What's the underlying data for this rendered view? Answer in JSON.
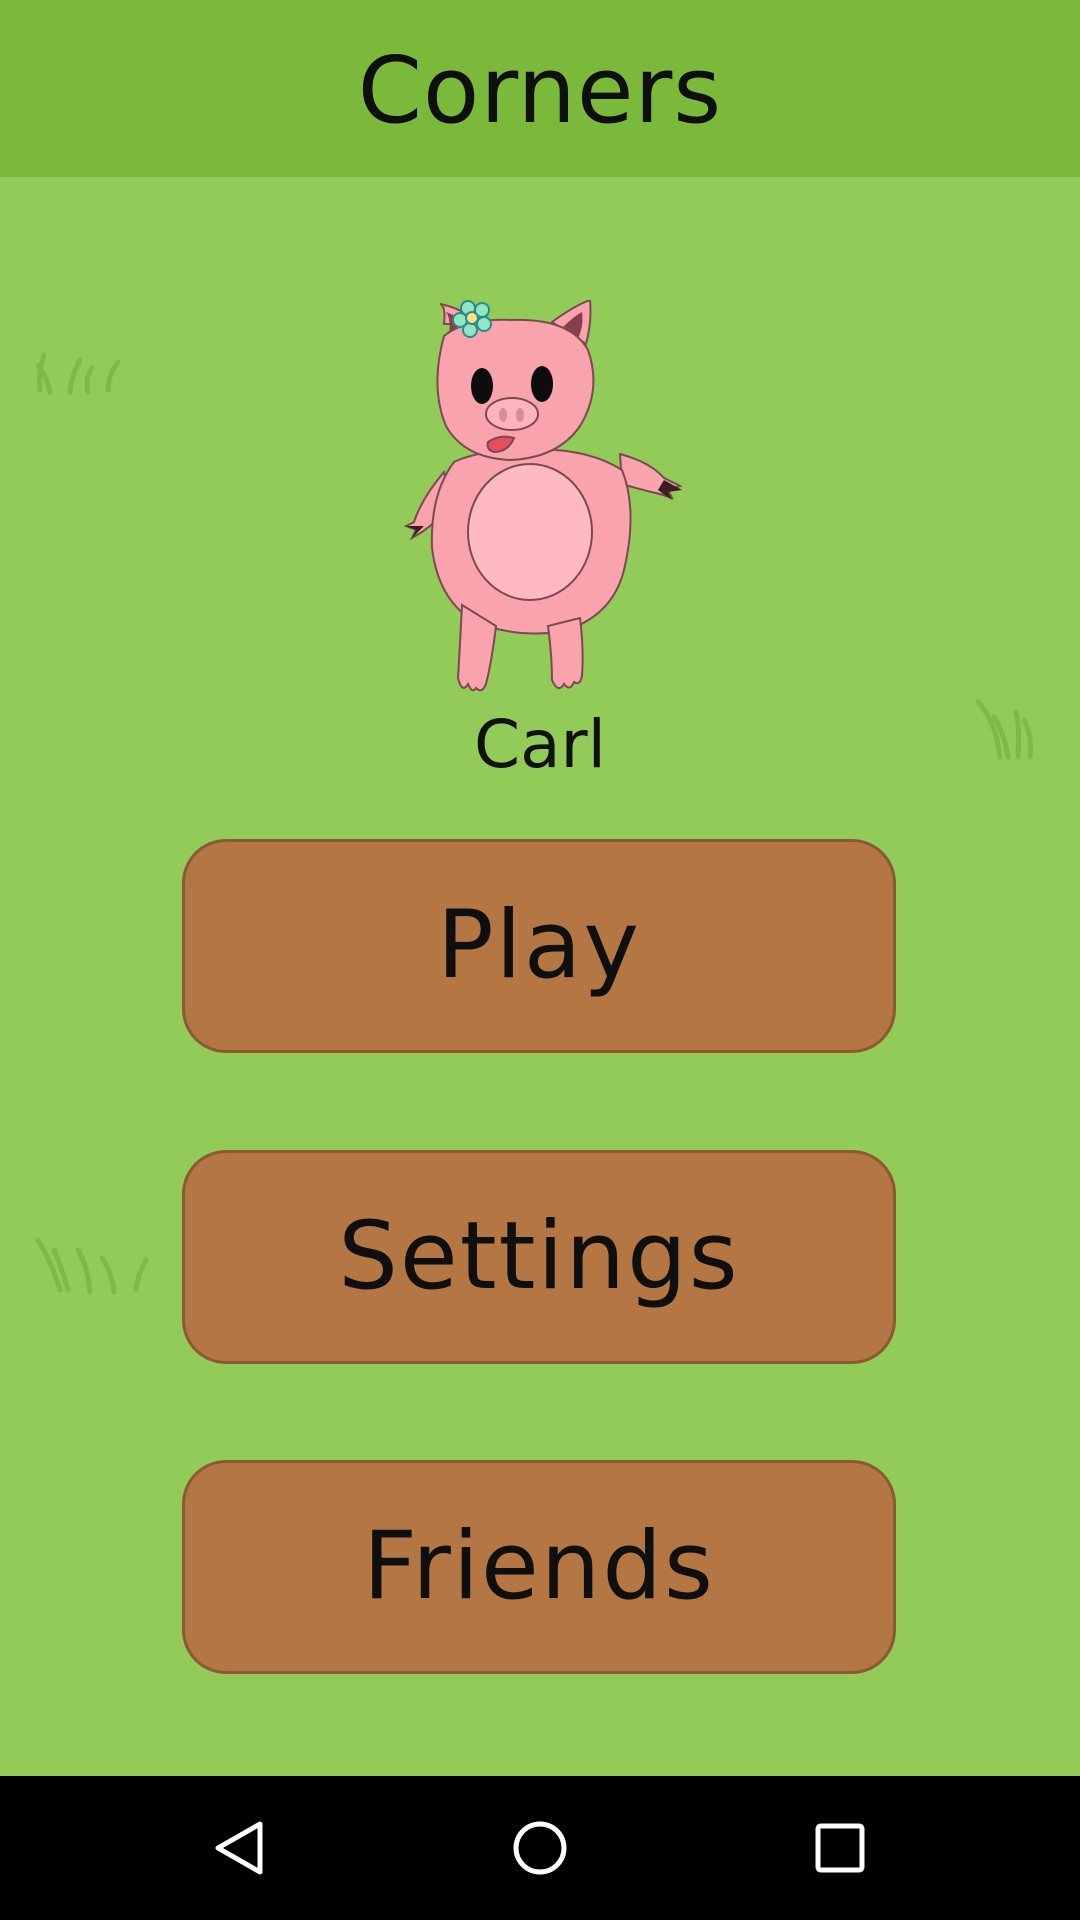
{
  "app": {
    "title": "Corners"
  },
  "character": {
    "name": "Carl",
    "icon": "pig-character-icon"
  },
  "menu": {
    "play_label": "Play",
    "settings_label": "Settings",
    "friends_label": "Friends"
  },
  "navigation": {
    "back_icon": "back-triangle-icon",
    "home_icon": "home-circle-icon",
    "recents_icon": "recents-square-icon"
  },
  "colors": {
    "background": "#92cb57",
    "app_bar": "#7ab93a",
    "button": "#b47642",
    "button_border": "#8a5a34",
    "nav_bar": "#000000"
  }
}
